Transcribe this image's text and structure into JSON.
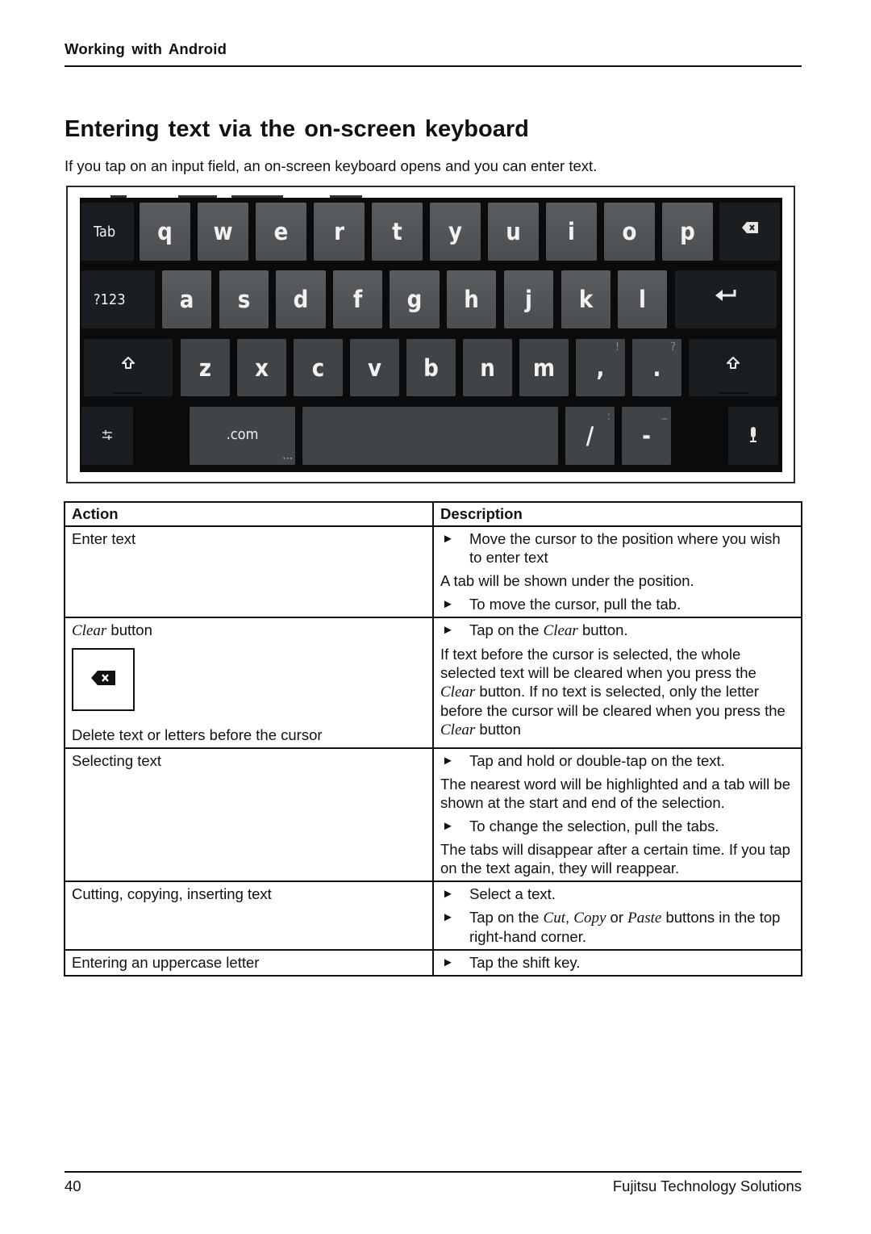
{
  "running_head": "Working with Android",
  "title": "Entering text via the on-screen keyboard",
  "intro": "If you tap on an input field, an on-screen keyboard opens and you can enter text.",
  "keyboard": {
    "colors": {
      "key": "#54575a",
      "function_key": "#1b1e21",
      "background": "#0a0b0c",
      "label": "#f2f2f2"
    },
    "row1": [
      "Tab",
      "q",
      "w",
      "e",
      "r",
      "t",
      "y",
      "u",
      "i",
      "o",
      "p"
    ],
    "row2": [
      "?123",
      "a",
      "s",
      "d",
      "f",
      "g",
      "h",
      "j",
      "k",
      "l"
    ],
    "row3": [
      "z",
      "x",
      "c",
      "v",
      "b",
      "n",
      "m",
      ",",
      "."
    ],
    "row3_hints": {
      ",": "!",
      ".": "?"
    },
    "row4": {
      "com": ".com",
      "slash": "/",
      "slash_hint": ":",
      "dash": "-",
      "dash_hint": "_"
    },
    "icons": {
      "backspace": "backspace-icon",
      "enter": "enter-arrow-icon",
      "shift": "shift-arrow-icon",
      "settings": "settings-sliders-icon",
      "mic": "microphone-icon"
    }
  },
  "table": {
    "headers": [
      "Action",
      "Description"
    ],
    "rows": {
      "enter_text": {
        "action": "Enter text",
        "b1": "Move the cursor to the position where you wish to enter text",
        "p1": "A tab will be shown under the position.",
        "b2": "To move the cursor, pull the tab."
      },
      "clear": {
        "action_italic": "Clear",
        "action_rest": " button",
        "action_note": "Delete text or letters before the cursor",
        "b1_pre": "Tap on the ",
        "b1_ital": "Clear",
        "b1_post": " button.",
        "p1_a": "If text before the cursor is selected, the whole selected text will be cleared when you press the ",
        "p1_ital1": "Clear",
        "p1_b": " button. If no text is selected, only the letter before the cursor will be cleared when you press the ",
        "p1_ital2": "Clear",
        "p1_c": " button"
      },
      "selecting": {
        "action": "Selecting text",
        "b1": "Tap and hold or double-tap on the text.",
        "p1": "The nearest word will be highlighted and a tab will be shown at the start and end of the selection.",
        "b2": "To change the selection, pull the tabs.",
        "p2": "The tabs will disappear after a certain time. If you tap on the text again, they will reappear."
      },
      "cutting": {
        "action": "Cutting, copying, inserting text",
        "b1": "Select a text.",
        "b2_pre": "Tap on the ",
        "b2_cut": "Cut",
        "b2_comma": ", ",
        "b2_copy": "Copy",
        "b2_or": " or ",
        "b2_paste": "Paste",
        "b2_post": " buttons in the top right-hand corner."
      },
      "uppercase": {
        "action": "Entering an uppercase letter",
        "b1": "Tap the shift key."
      }
    },
    "bullet_glyph": "►"
  },
  "footer": {
    "page_number": "40",
    "publisher": "Fujitsu Technology Solutions"
  }
}
